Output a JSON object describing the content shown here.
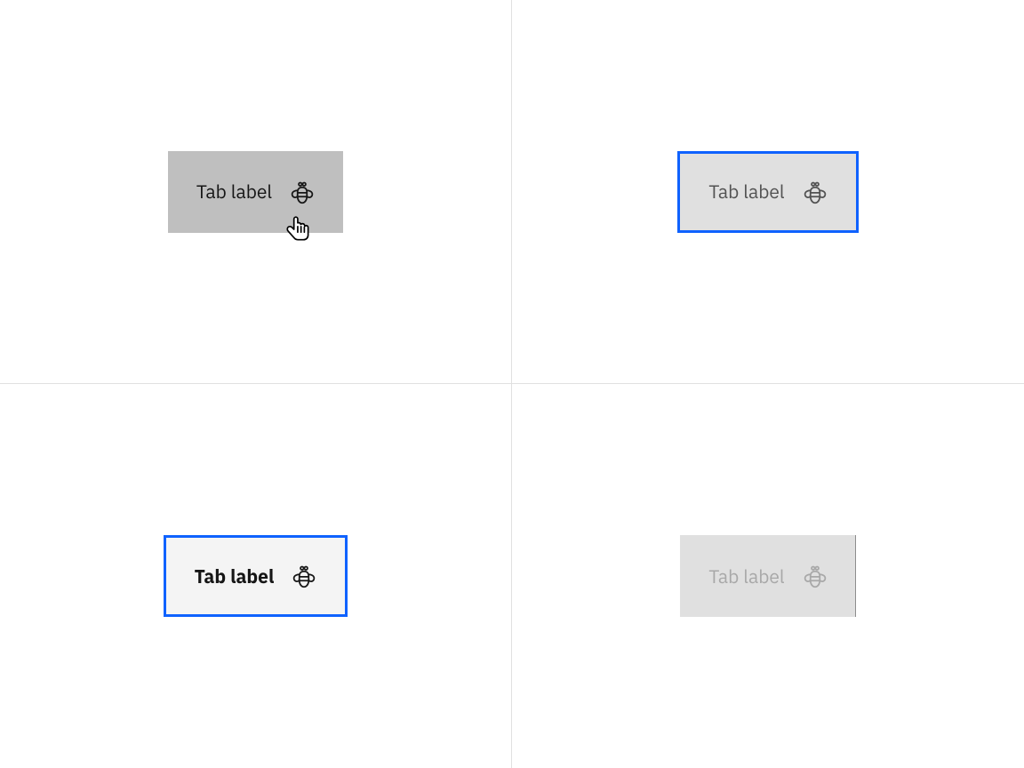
{
  "tabs": {
    "hover": {
      "label": "Tab label",
      "icon": "bee-icon"
    },
    "focus": {
      "label": "Tab label",
      "icon": "bee-icon"
    },
    "selected_focus": {
      "label": "Tab label",
      "icon": "bee-icon"
    },
    "disabled": {
      "label": "Tab label",
      "icon": "bee-icon"
    }
  },
  "colors": {
    "focus_outline": "#0f62fe",
    "hover_bg": "#bfbfbf",
    "focus_bg": "#e0e0e0",
    "selected_bg": "#f4f4f4",
    "disabled_bg": "#e0e0e0",
    "text_primary": "#161616",
    "text_secondary": "#525252",
    "text_disabled": "#a8a8a8",
    "divider": "#e0e0e0"
  }
}
